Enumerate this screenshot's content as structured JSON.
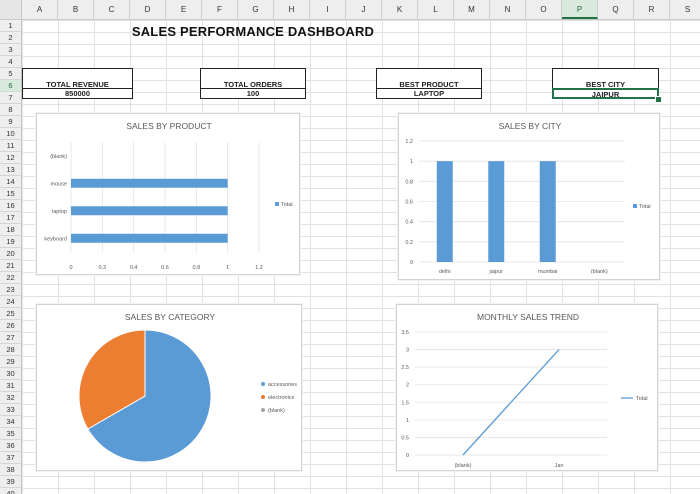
{
  "columns": [
    "A",
    "B",
    "C",
    "D",
    "E",
    "F",
    "G",
    "H",
    "I",
    "J",
    "K",
    "L",
    "M",
    "N",
    "O",
    "P",
    "Q",
    "R",
    "S"
  ],
  "selected_column": "P",
  "rows": [
    "1",
    "2",
    "3",
    "4",
    "5",
    "6",
    "7",
    "8",
    "9",
    "10",
    "11",
    "12",
    "13",
    "14",
    "15",
    "16",
    "17",
    "18",
    "19",
    "20",
    "21",
    "22",
    "23",
    "24",
    "25",
    "26",
    "27",
    "28",
    "29",
    "30",
    "31",
    "32",
    "33",
    "34",
    "35",
    "36",
    "37",
    "38",
    "39",
    "40"
  ],
  "selected_row": "6",
  "dashboard": {
    "title": "SALES PERFORMANCE DASHBOARD",
    "kpis": [
      {
        "label": "TOTAL REVENUE",
        "value": "850000"
      },
      {
        "label": "TOTAL ORDERS",
        "value": "100"
      },
      {
        "label": "BEST PRODUCT",
        "value": "LAPTOP"
      },
      {
        "label": "BEST CITY",
        "value": "JAIPUR"
      }
    ]
  },
  "colors": {
    "blue": "#5b9bd5",
    "orange": "#ed7d31",
    "gray": "#a5a5a5",
    "selection": "#217346"
  },
  "chart_data": [
    {
      "type": "bar",
      "title": "SALES BY PRODUCT",
      "categories": [
        "(blank)",
        "mouse",
        "laptop",
        "keyboard"
      ],
      "series": [
        {
          "name": "Total",
          "values": [
            null,
            1,
            1,
            1
          ]
        }
      ],
      "xlim": [
        0,
        1.2
      ],
      "xticks": [
        "0",
        "0.2",
        "0.4",
        "0.6",
        "0.8",
        "1",
        "1.2"
      ],
      "grid": true,
      "legend": "right"
    },
    {
      "type": "bar",
      "title": "SALES BY CITY",
      "categories": [
        "delhi",
        "jaipur",
        "mumbai",
        "(blank)"
      ],
      "series": [
        {
          "name": "Total",
          "values": [
            1,
            1,
            1,
            null
          ]
        }
      ],
      "ylim": [
        0,
        1.2
      ],
      "yticks": [
        "0",
        "0.2",
        "0.4",
        "0.6",
        "0.8",
        "1",
        "1.2"
      ],
      "grid": true,
      "legend": "right"
    },
    {
      "type": "pie",
      "title": "SALES BY CATEGORY",
      "labels": [
        "accessories",
        "electronics",
        "(blank)"
      ],
      "values": [
        2,
        1,
        0
      ],
      "legend": "right"
    },
    {
      "type": "line",
      "title": "MONTHLY SALES TREND",
      "categories": [
        "(blank)",
        "Jan"
      ],
      "series": [
        {
          "name": "Total",
          "values": [
            0,
            3
          ]
        }
      ],
      "ylim": [
        0,
        3.5
      ],
      "yticks": [
        "0",
        "0.5",
        "1",
        "1.5",
        "2",
        "2.5",
        "3",
        "3.5"
      ],
      "grid": true,
      "legend": "right"
    }
  ]
}
